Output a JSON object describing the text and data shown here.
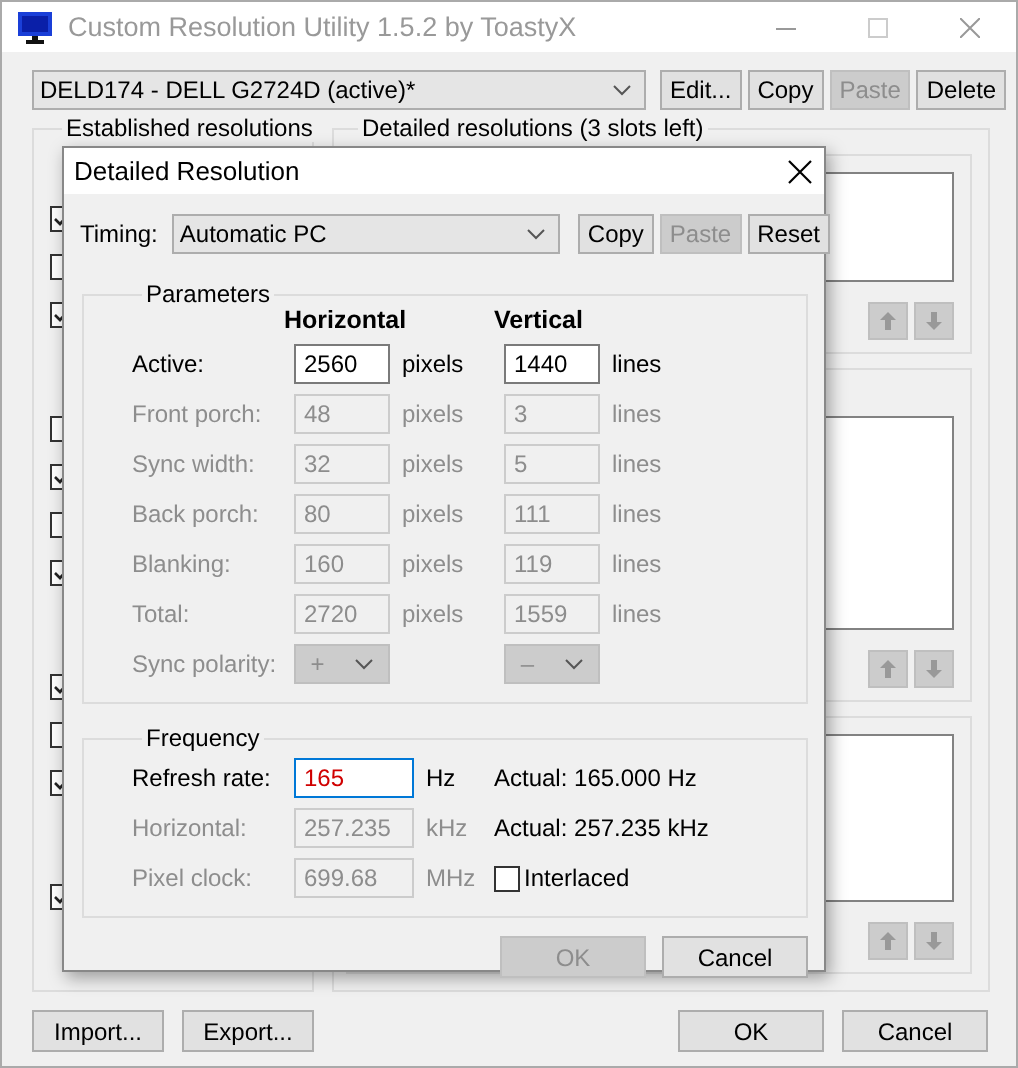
{
  "window": {
    "title": "Custom Resolution Utility 1.5.2 by ToastyX",
    "active": false
  },
  "display": {
    "value": "DELD174 - DELL G2724D (active)*"
  },
  "toolbar_buttons": [
    {
      "label": "Edit...",
      "disabled": false
    },
    {
      "label": "Copy",
      "disabled": false
    },
    {
      "label": "Paste",
      "disabled": true
    },
    {
      "label": "Delete",
      "disabled": false
    }
  ],
  "established": {
    "title": "Established resolutions",
    "checkbox_groups": [
      [
        {
          "checked": true
        },
        {
          "checked": false
        },
        {
          "checked": true
        }
      ],
      [
        {
          "checked": false
        },
        {
          "checked": true
        },
        {
          "checked": false
        },
        {
          "checked": true
        }
      ],
      [
        {
          "checked": true
        },
        {
          "checked": false
        },
        {
          "checked": true
        }
      ],
      [
        {
          "checked": true
        }
      ]
    ]
  },
  "detailed": {
    "title": "Detailed resolutions (3 slots left)"
  },
  "footer": {
    "left": [
      {
        "label": "Import..."
      },
      {
        "label": "Export..."
      }
    ],
    "right": [
      {
        "label": "OK"
      },
      {
        "label": "Cancel"
      }
    ]
  },
  "dialog": {
    "title": "Detailed Resolution",
    "timing": {
      "label": "Timing:",
      "value": "Automatic PC"
    },
    "buttons": [
      {
        "label": "Copy",
        "disabled": false
      },
      {
        "label": "Paste",
        "disabled": true
      },
      {
        "label": "Reset",
        "disabled": false
      }
    ],
    "parameters": {
      "title": "Parameters",
      "columns": [
        "Horizontal",
        "Vertical"
      ],
      "rows": [
        {
          "kind": "field",
          "label": "Active:",
          "enabled": true,
          "horizontal": "2560",
          "horizontal_unit": "pixels",
          "vertical": "1440",
          "vertical_unit": "lines"
        },
        {
          "kind": "field",
          "label": "Front porch:",
          "enabled": false,
          "horizontal": "48",
          "horizontal_unit": "pixels",
          "vertical": "3",
          "vertical_unit": "lines"
        },
        {
          "kind": "field",
          "label": "Sync width:",
          "enabled": false,
          "horizontal": "32",
          "horizontal_unit": "pixels",
          "vertical": "5",
          "vertical_unit": "lines"
        },
        {
          "kind": "field",
          "label": "Back porch:",
          "enabled": false,
          "horizontal": "80",
          "horizontal_unit": "pixels",
          "vertical": "111",
          "vertical_unit": "lines"
        },
        {
          "kind": "field",
          "label": "Blanking:",
          "enabled": false,
          "horizontal": "160",
          "horizontal_unit": "pixels",
          "vertical": "119",
          "vertical_unit": "lines"
        },
        {
          "kind": "field",
          "label": "Total:",
          "enabled": false,
          "horizontal": "2720",
          "horizontal_unit": "pixels",
          "vertical": "1559",
          "vertical_unit": "lines"
        },
        {
          "kind": "dropdown",
          "label": "Sync polarity:",
          "enabled": false,
          "horizontal": "+",
          "vertical": "–"
        }
      ]
    },
    "frequency": {
      "title": "Frequency",
      "rows": [
        {
          "label": "Refresh rate:",
          "enabled": true,
          "focused": true,
          "modified": true,
          "value": "165",
          "unit": "Hz",
          "note": "Actual: 165.000 Hz"
        },
        {
          "label": "Horizontal:",
          "enabled": false,
          "focused": false,
          "modified": false,
          "value": "257.235",
          "unit": "kHz",
          "note": "Actual: 257.235 kHz"
        },
        {
          "label": "Pixel clock:",
          "enabled": false,
          "focused": false,
          "modified": false,
          "value": "699.68",
          "unit": "MHz",
          "checkbox": {
            "label": "Interlaced",
            "checked": false
          }
        }
      ]
    },
    "actions": [
      {
        "label": "OK",
        "disabled": true
      },
      {
        "label": "Cancel",
        "disabled": false
      }
    ]
  }
}
